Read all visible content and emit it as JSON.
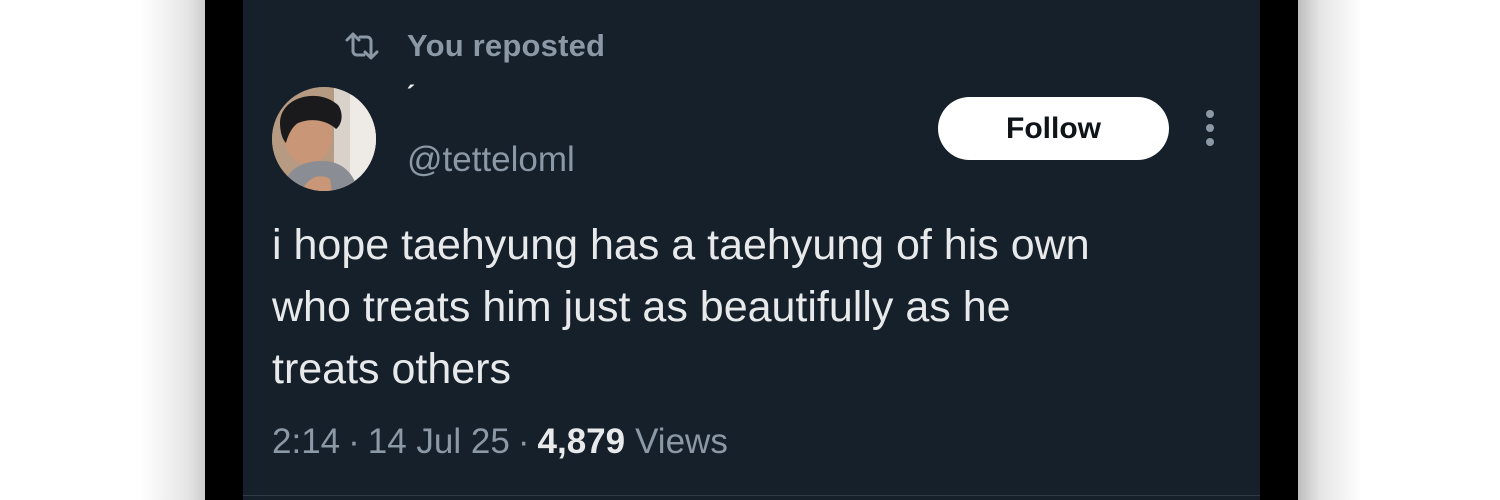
{
  "repost": {
    "icon": "repost-icon",
    "label": "You reposted"
  },
  "author": {
    "display_name": "ˊ",
    "handle": "@tetteloml",
    "avatar": "avatar-photo"
  },
  "follow_button": {
    "label": "Follow"
  },
  "more_menu": {
    "icon": "more-vertical-icon"
  },
  "tweet": {
    "lines": [
      "i hope taehyung has a taehyung of his own",
      "who treats him just as beautifully as he",
      "treats others"
    ]
  },
  "meta": {
    "time": "2:14",
    "separator": "·",
    "date": "14 Jul 25",
    "views_count": "4,879",
    "views_label": "Views"
  },
  "colors": {
    "background": "#16202b",
    "primary_text": "#e7e9ea",
    "secondary_text": "#8b98a5",
    "button_bg": "#ffffff",
    "button_text": "#0f1419"
  }
}
